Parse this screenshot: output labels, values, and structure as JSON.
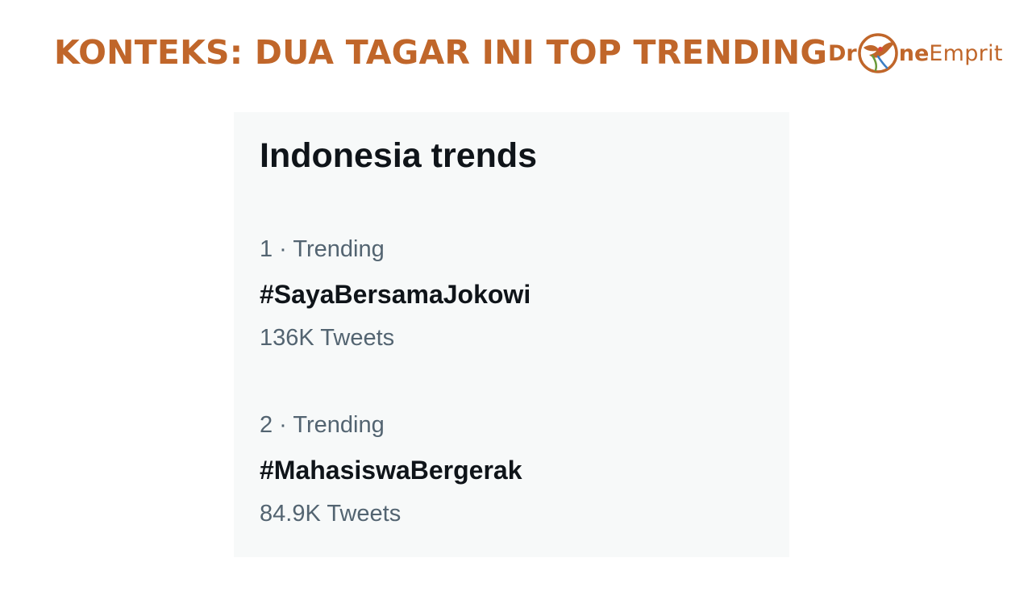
{
  "slide": {
    "title": "KONTEKS: DUA TAGAR INI TOP TRENDING"
  },
  "logo": {
    "text_start": "Dr",
    "text_bold_end": "ne",
    "text_end": "Emprit",
    "emblem_icon": "drone-bird-emblem",
    "color": "#c0662a"
  },
  "trends": {
    "heading": "Indonesia trends",
    "items": [
      {
        "meta": "1 · Trending",
        "name": "#SayaBersamaJokowi",
        "count": "136K Tweets"
      },
      {
        "meta": "2 · Trending",
        "name": "#MahasiswaBergerak",
        "count": "84.9K Tweets"
      }
    ]
  },
  "colors": {
    "accent": "#c0662a",
    "card_background": "#f7f9f9",
    "primary_text": "#0f1419",
    "secondary_text": "#536471"
  }
}
